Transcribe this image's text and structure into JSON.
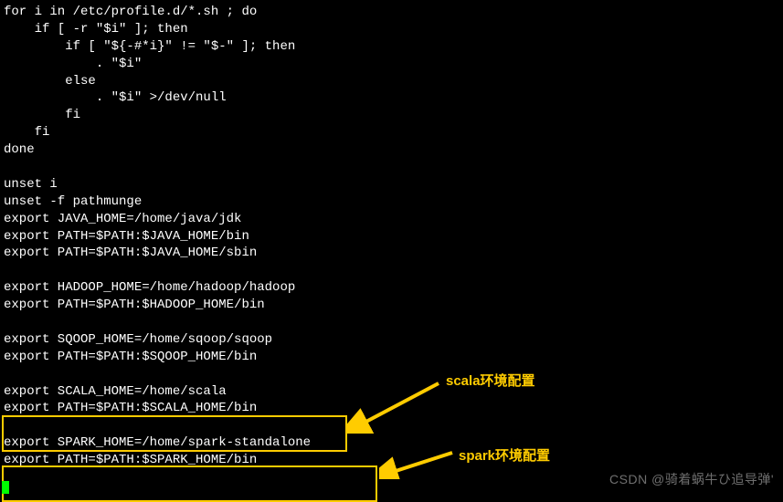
{
  "terminal": {
    "lines": [
      "for i in /etc/profile.d/*.sh ; do",
      "    if [ -r \"$i\" ]; then",
      "        if [ \"${-#*i}\" != \"$-\" ]; then",
      "            . \"$i\"",
      "        else",
      "            . \"$i\" >/dev/null",
      "        fi",
      "    fi",
      "done",
      "",
      "unset i",
      "unset -f pathmunge",
      "export JAVA_HOME=/home/java/jdk",
      "export PATH=$PATH:$JAVA_HOME/bin",
      "export PATH=$PATH:$JAVA_HOME/sbin",
      "",
      "export HADOOP_HOME=/home/hadoop/hadoop",
      "export PATH=$PATH:$HADOOP_HOME/bin",
      "",
      "export SQOOP_HOME=/home/sqoop/sqoop",
      "export PATH=$PATH:$SQOOP_HOME/bin",
      "",
      "export SCALA_HOME=/home/scala",
      "export PATH=$PATH:$SCALA_HOME/bin",
      "",
      "export SPARK_HOME=/home/spark-standalone",
      "export PATH=$PATH:$SPARK_HOME/bin"
    ]
  },
  "annotations": {
    "scala": "scala环境配置",
    "spark": "spark环境配置"
  },
  "watermark": "CSDN @骑着蜗牛ひ追导弹'",
  "highlight_color": "#ffcc00"
}
